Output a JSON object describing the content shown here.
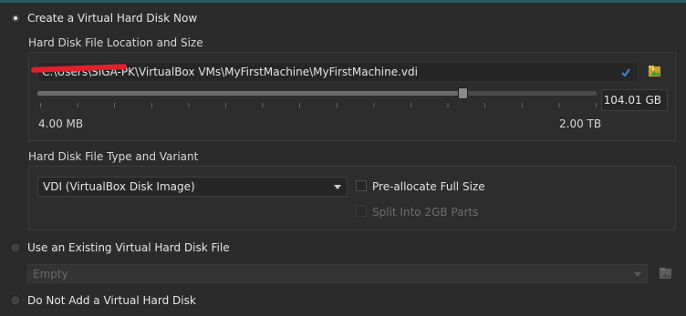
{
  "create_now": {
    "label": "Create a Virtual Hard Disk Now",
    "selected": true
  },
  "location_size": {
    "heading": "Hard Disk File Location and Size",
    "path_value": "C:\\Users\\SIGA-PK\\VirtualBox VMs\\MyFirstMachine\\MyFirstMachine.vdi",
    "size_value": "104.01 GB",
    "min_label": "4.00 MB",
    "max_label": "2.00 TB",
    "slider_fraction": 0.76
  },
  "type_variant": {
    "heading": "Hard Disk File Type and Variant",
    "type_value": "VDI (VirtualBox Disk Image)",
    "preallocate_label": "Pre-allocate Full Size",
    "split_label": "Split Into 2GB Parts"
  },
  "existing": {
    "label": "Use an Existing Virtual Hard Disk File",
    "combo_value": "Empty"
  },
  "none": {
    "label": "Do Not Add a Virtual Hard Disk"
  },
  "colors": {
    "accent": "#2e5a63",
    "redaction": "#e0202a",
    "check": "#3a86d6"
  },
  "icons": {
    "folder_icon": "folder-open-icon",
    "check_icon": "checkmark-icon"
  }
}
